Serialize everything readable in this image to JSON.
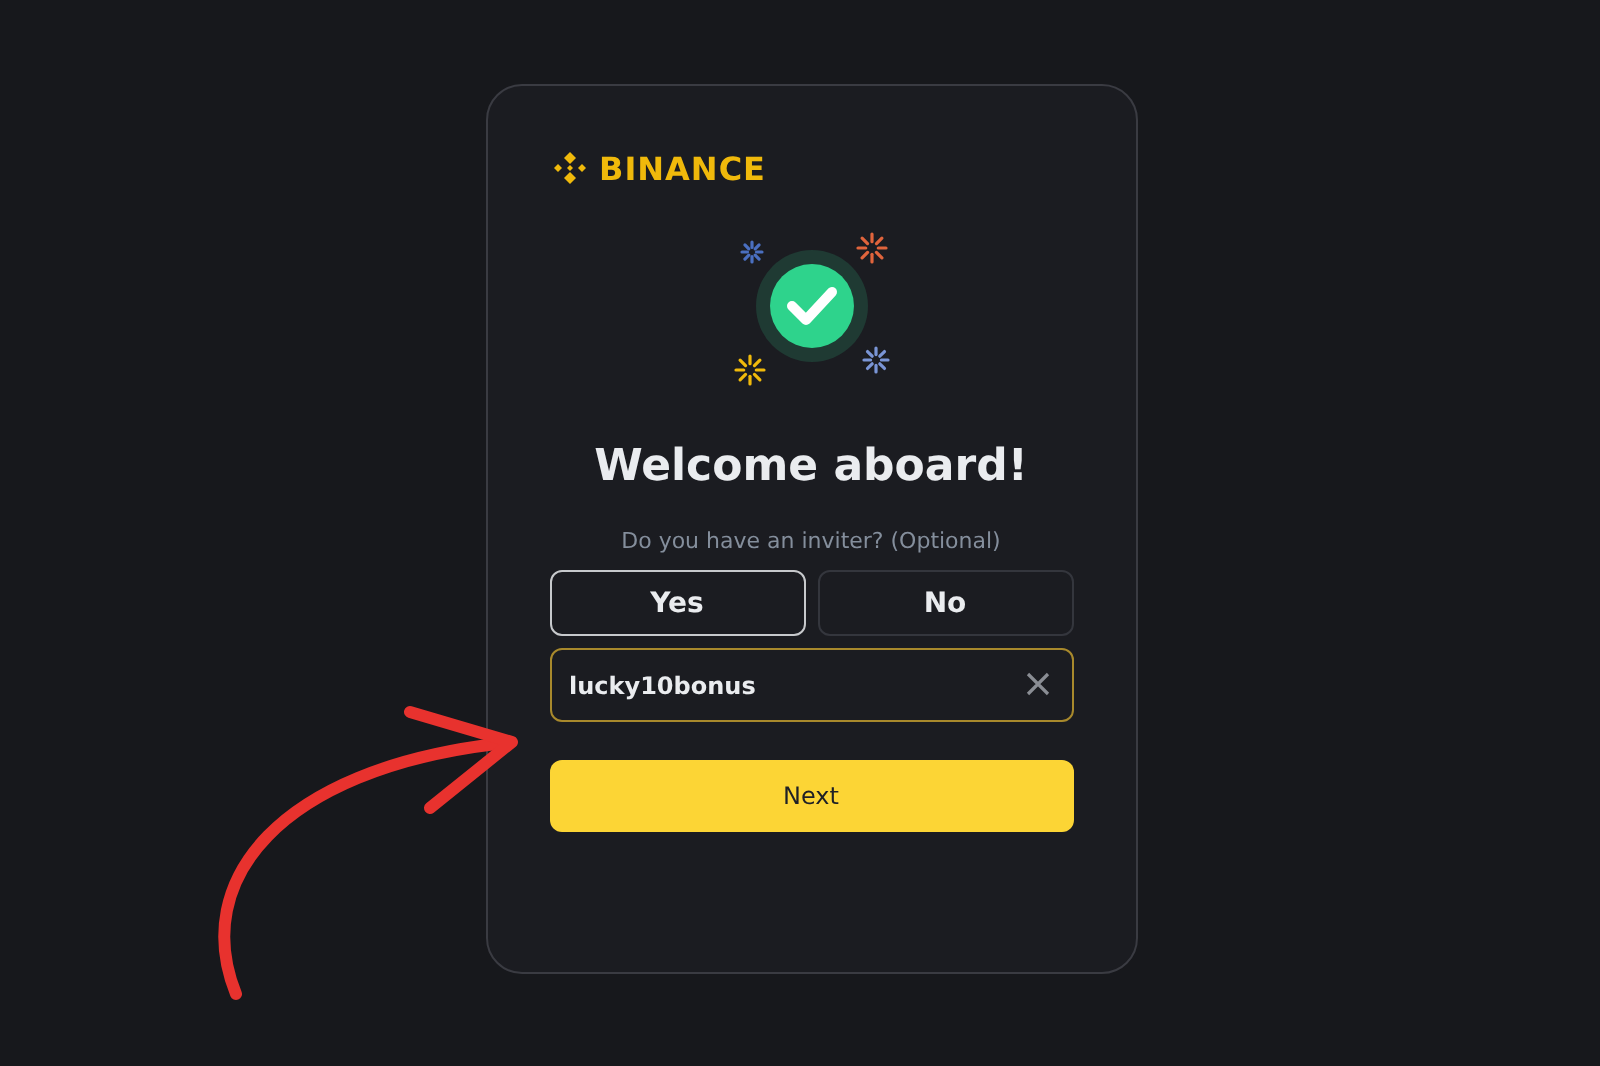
{
  "brand": "BINANCE",
  "title": "Welcome aboard!",
  "question": "Do you have an inviter? (Optional)",
  "choices": [
    {
      "label": "Yes",
      "selected": true
    },
    {
      "label": "No",
      "selected": false
    }
  ],
  "referral_field": {
    "value": "lucky10bonus"
  },
  "next_button": "Next"
}
